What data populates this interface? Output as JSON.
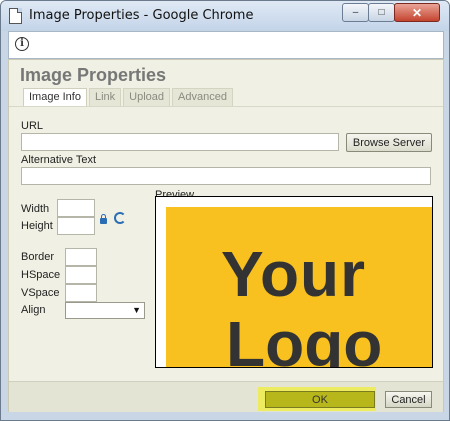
{
  "window": {
    "title": "Image Properties - Google Chrome",
    "controls": {
      "minimize": "–",
      "maximize": "□",
      "close": "✕"
    }
  },
  "infobar": {
    "icon": "info-icon",
    "glyph": "i"
  },
  "dialog": {
    "title": "Image Properties",
    "tabs": [
      {
        "label": "Image Info",
        "active": true
      },
      {
        "label": "Link",
        "active": false
      },
      {
        "label": "Upload",
        "active": false
      },
      {
        "label": "Advanced",
        "active": false
      }
    ],
    "fields": {
      "url_label": "URL",
      "url_value": "",
      "browse_server": "Browse Server",
      "alt_text_label": "Alternative Text",
      "alt_text_value": "",
      "width_label": "Width",
      "width_value": "",
      "height_label": "Height",
      "height_value": "",
      "border_label": "Border",
      "border_value": "",
      "hspace_label": "HSpace",
      "hspace_value": "",
      "vspace_label": "VSpace",
      "vspace_value": "",
      "align_label": "Align",
      "align_value": "",
      "align_arrow": "▼"
    },
    "preview": {
      "label": "Preview",
      "logo_line1": "Your",
      "logo_line2": "Logo",
      "logo_color": "#f8c11f"
    },
    "buttons": {
      "ok": "OK",
      "cancel": "Cancel"
    }
  },
  "colors": {
    "dialog_bg": "#f0f0e4",
    "ok_highlight": "#f4f200",
    "ok_button": "#b7b71b",
    "icon_blue": "#2a6db5"
  }
}
